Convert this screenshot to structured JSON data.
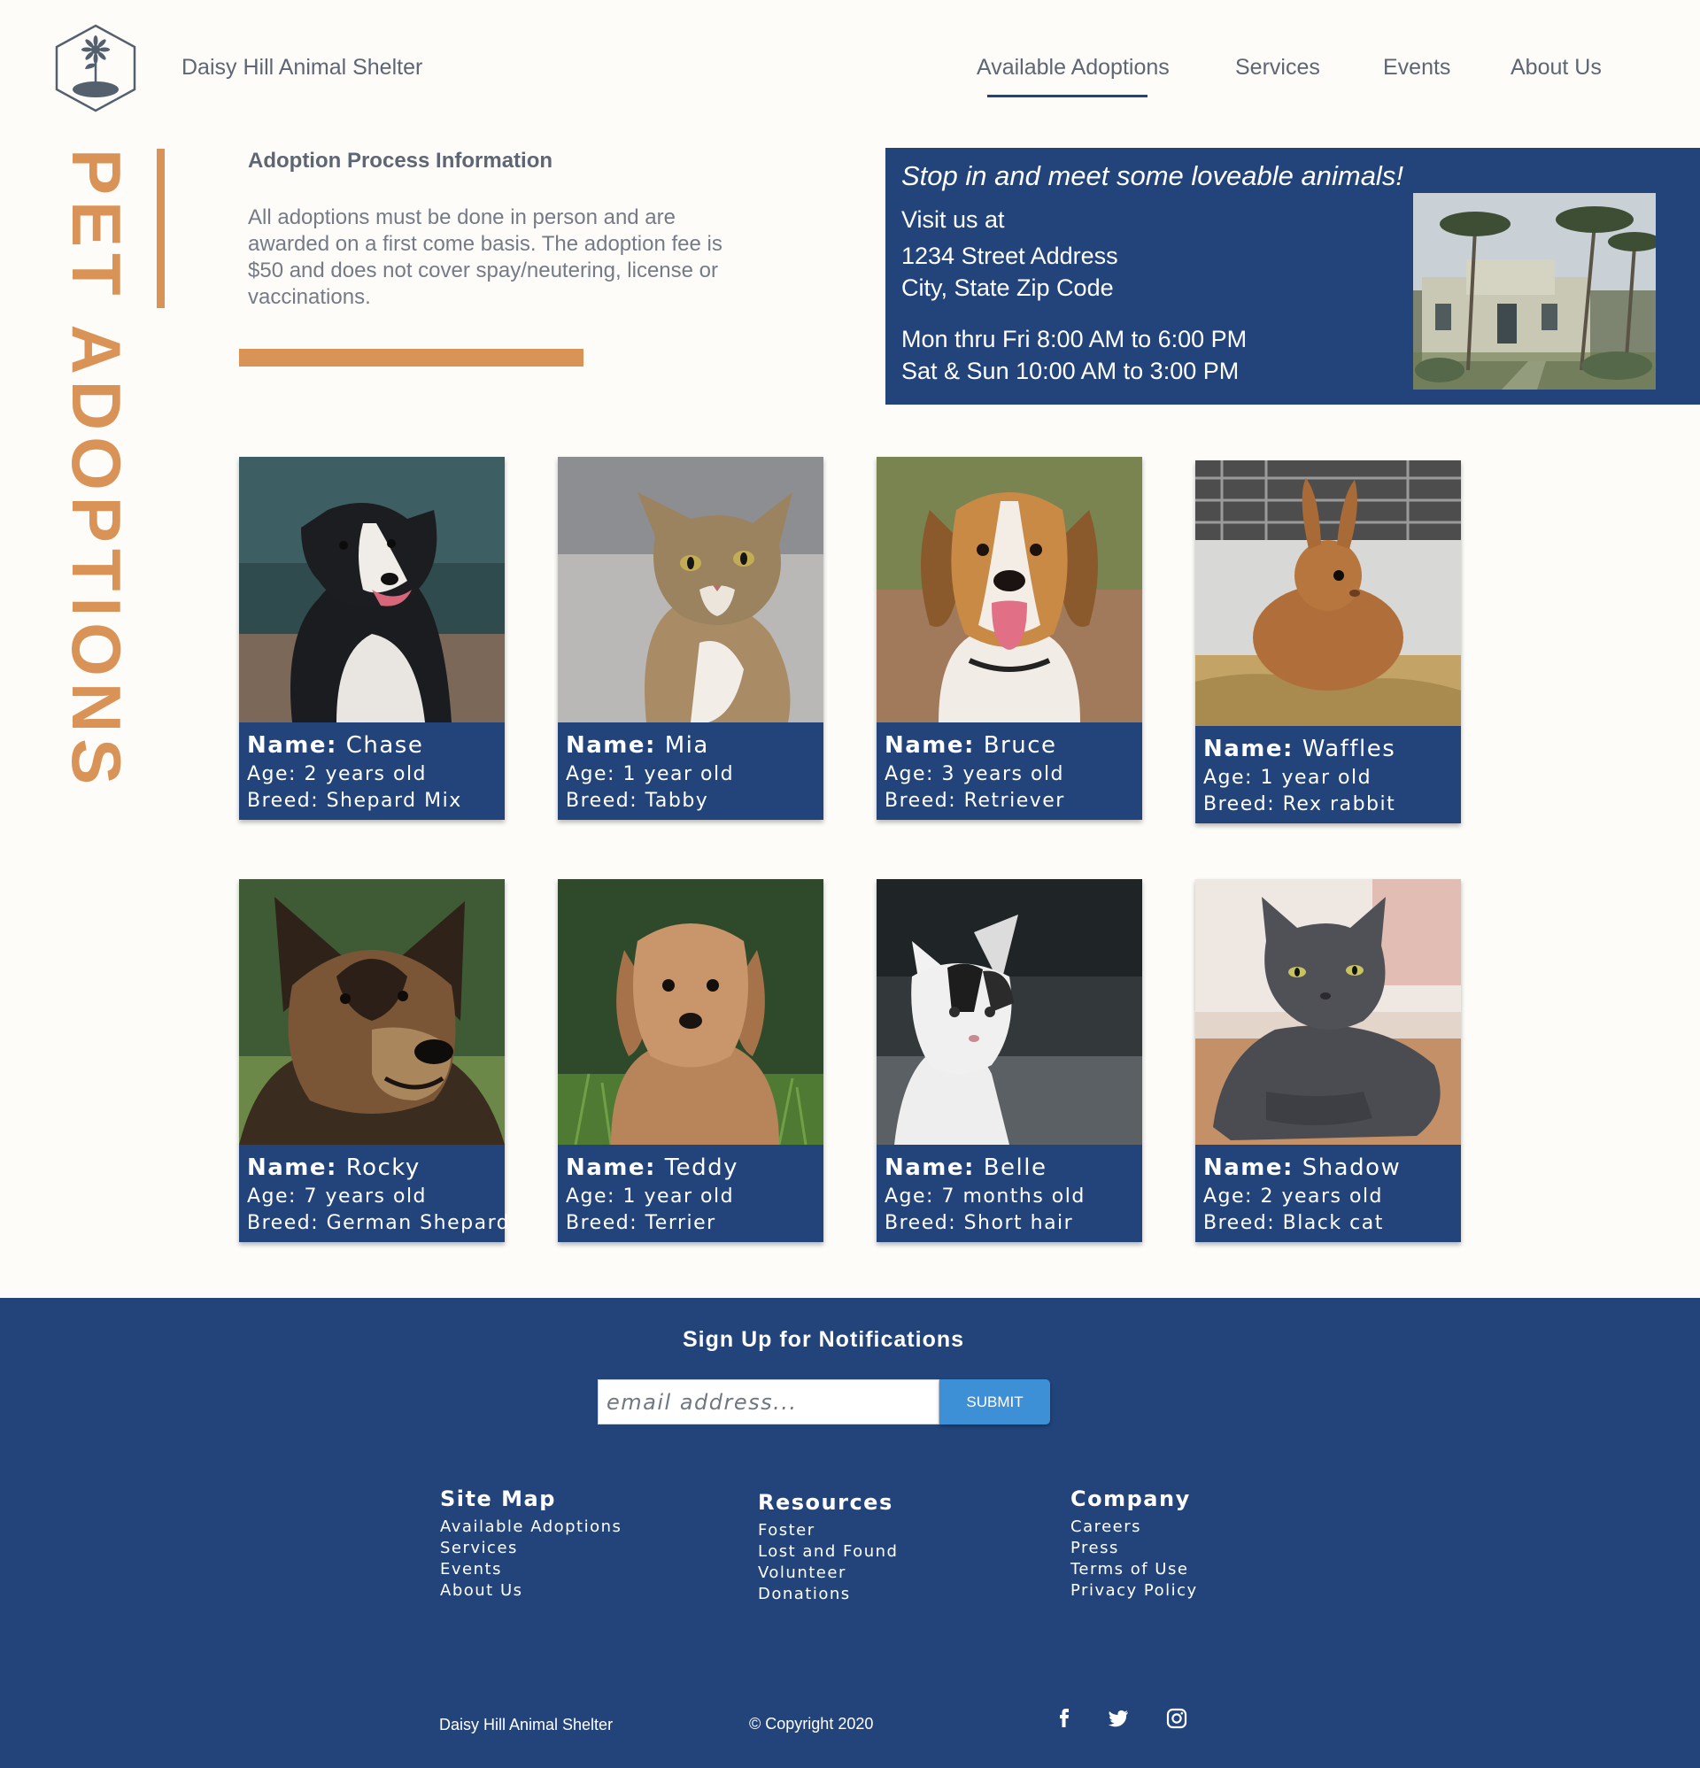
{
  "header": {
    "brand": "Daisy Hill Animal Shelter",
    "nav": [
      "Available Adoptions",
      "Services",
      "Events",
      "About Us"
    ],
    "active_nav": "Available Adoptions"
  },
  "sidebar_title": "PET ADOPTIONS",
  "adoption_info": {
    "title": "Adoption Process Information",
    "text": "All adoptions must be done in person and are awarded on a first come basis. The adoption fee is $50 and does not cover spay/neutering, license or vaccinations."
  },
  "visit": {
    "tagline": "Stop in and meet some loveable animals!",
    "visit_label": "Visit us at",
    "address1": "1234 Street Address",
    "address2": "City, State Zip Code",
    "hours1": "Mon thru Fri 8:00 AM to 6:00 PM",
    "hours2": "Sat & Sun 10:00 AM to 3:00 PM"
  },
  "labels": {
    "name": "Name:"
  },
  "pets": [
    {
      "name": "Chase",
      "age": "Age: 2 years old",
      "breed": "Breed: Shepard Mix"
    },
    {
      "name": "Mia",
      "age": "Age: 1 year old",
      "breed": "Breed: Tabby"
    },
    {
      "name": "Bruce",
      "age": "Age: 3 years old",
      "breed": "Breed: Retriever"
    },
    {
      "name": "Waffles",
      "age": "Age: 1 year old",
      "breed": "Breed: Rex rabbit"
    },
    {
      "name": "Rocky",
      "age": "Age: 7 years old",
      "breed": "Breed: German Shepard"
    },
    {
      "name": "Teddy",
      "age": "Age: 1 year old",
      "breed": "Breed: Terrier"
    },
    {
      "name": "Belle",
      "age": "Age: 7 months old",
      "breed": "Breed: Short hair"
    },
    {
      "name": "Shadow",
      "age": "Age: 2 years old",
      "breed": "Breed: Black cat"
    }
  ],
  "footer": {
    "signup_title": "Sign Up for Notifications",
    "email_placeholder": "email address...",
    "submit_label": "SUBMIT",
    "sitemap": {
      "title": "Site Map",
      "items": [
        "Available Adoptions",
        "Services",
        "Events",
        "About Us"
      ]
    },
    "resources": {
      "title": "Resources",
      "items": [
        "Foster",
        "Lost and Found",
        "Volunteer",
        "Donations"
      ]
    },
    "company": {
      "title": "Company",
      "items": [
        "Careers",
        "Press",
        "Terms of Use",
        "Privacy Policy"
      ]
    },
    "brand": "Daisy Hill Animal Shelter",
    "copyright": "Copyright 2020",
    "social_icons": [
      "facebook-icon",
      "twitter-icon",
      "instagram-icon"
    ]
  },
  "colors": {
    "navy": "#22447a",
    "orange": "#da9356",
    "submit_blue": "#3d8fd6",
    "background": "#fdfcf9"
  }
}
